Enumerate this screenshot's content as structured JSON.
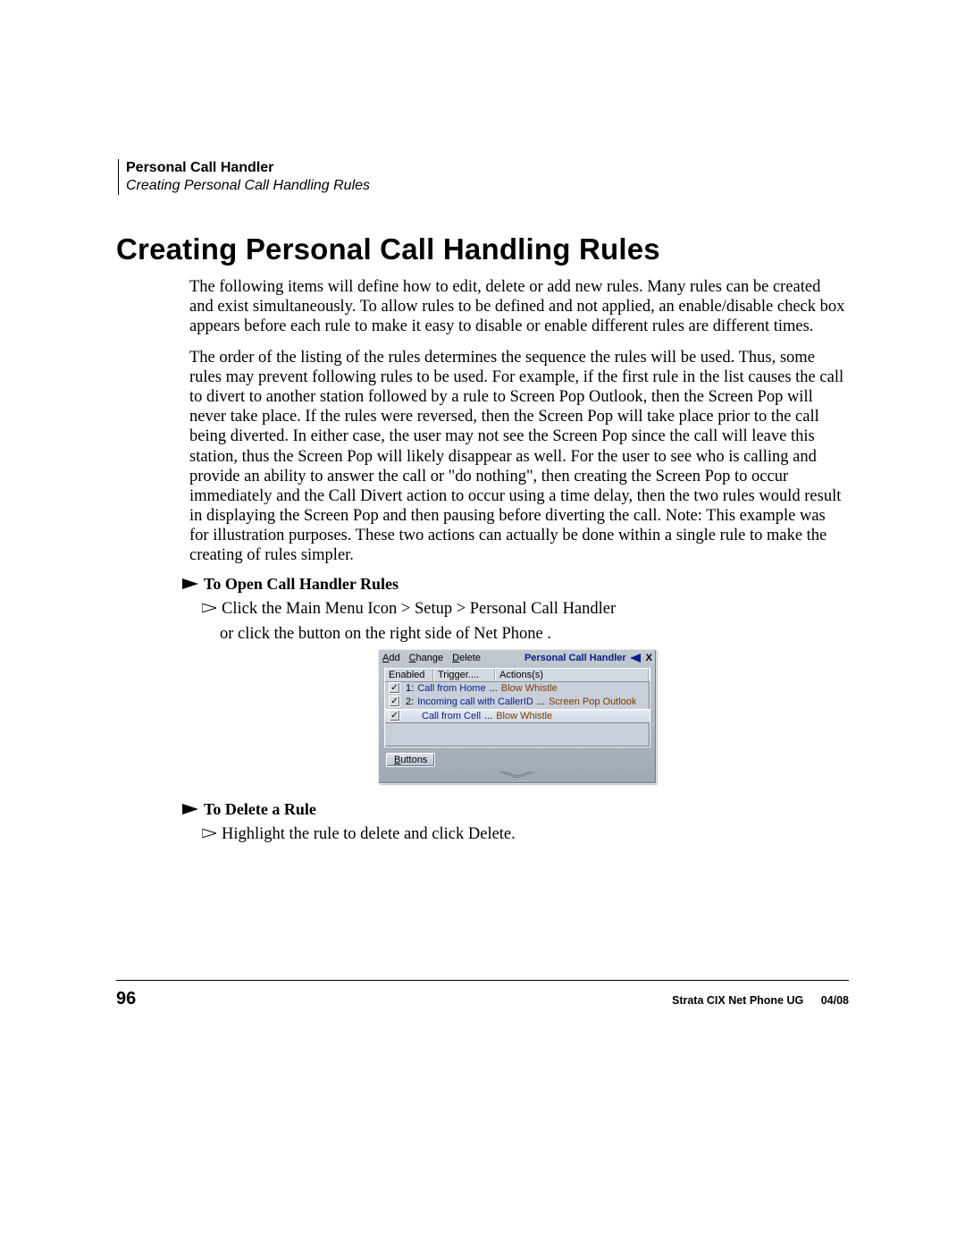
{
  "header": {
    "chapter": "Personal Call Handler",
    "subchapter": "Creating Personal Call Handling Rules"
  },
  "title": "Creating Personal Call Handling Rules",
  "paragraphs": {
    "p1": "The following items will define how to edit, delete or add new rules.  Many rules can be created and exist simultaneously.  To allow rules to be defined and not applied, an enable/disable check box appears before each rule to make it easy to disable or enable different rules are different times.",
    "p2": "The order of the listing of the rules determines the sequence the rules will be used.  Thus, some rules may prevent following rules to be used.  For example, if the first rule in the list causes the call to divert to another station followed by a rule to Screen Pop Outlook, then the Screen Pop will never take place.  If the rules were reversed, then the Screen Pop will take place prior to the call being diverted.  In either case, the user may not see the Screen Pop since the call will leave this station, thus the Screen Pop will likely disappear as well.  For the user to see who is calling and provide an ability to answer the call or \"do nothing\", then creating the Screen Pop to occur immediately and the Call Divert action to occur using a time delay, then the two rules would result in displaying the Screen Pop and then pausing before diverting the call.  Note: This example was for illustration purposes.  These two actions can actually be done within a single rule to make the creating of rules simpler."
  },
  "subsections": {
    "open": {
      "heading": "To Open Call Handler Rules",
      "step": "Click the Main Menu Icon > Setup > Personal Call Handler",
      "followup": "or click the button on the right side of Net Phone ."
    },
    "delete": {
      "heading": "To Delete a Rule",
      "step": "Highlight the rule to delete and click Delete."
    }
  },
  "app": {
    "menu": {
      "add": "Add",
      "change": "Change",
      "delete": "Delete"
    },
    "title": "Personal Call Handler",
    "close": "X",
    "columns": {
      "enabled": "Enabled",
      "trigger": "Trigger....",
      "actions": "Actions(s)"
    },
    "rows": [
      {
        "checked": true,
        "idx": "1:",
        "trigger": "Call from Home",
        "action": "Blow Whistle",
        "selected": false
      },
      {
        "checked": true,
        "idx": "2:",
        "trigger": "Incoming call with CallerID",
        "action": "Screen Pop Outlook",
        "selected": false
      },
      {
        "checked": true,
        "idx": "",
        "trigger": "Call from Cell",
        "action": "Blow Whistle",
        "selected": true
      }
    ],
    "buttons_label": "Buttons"
  },
  "footer": {
    "page": "96",
    "doc": "Strata CIX Net Phone UG",
    "date": "04/08"
  }
}
